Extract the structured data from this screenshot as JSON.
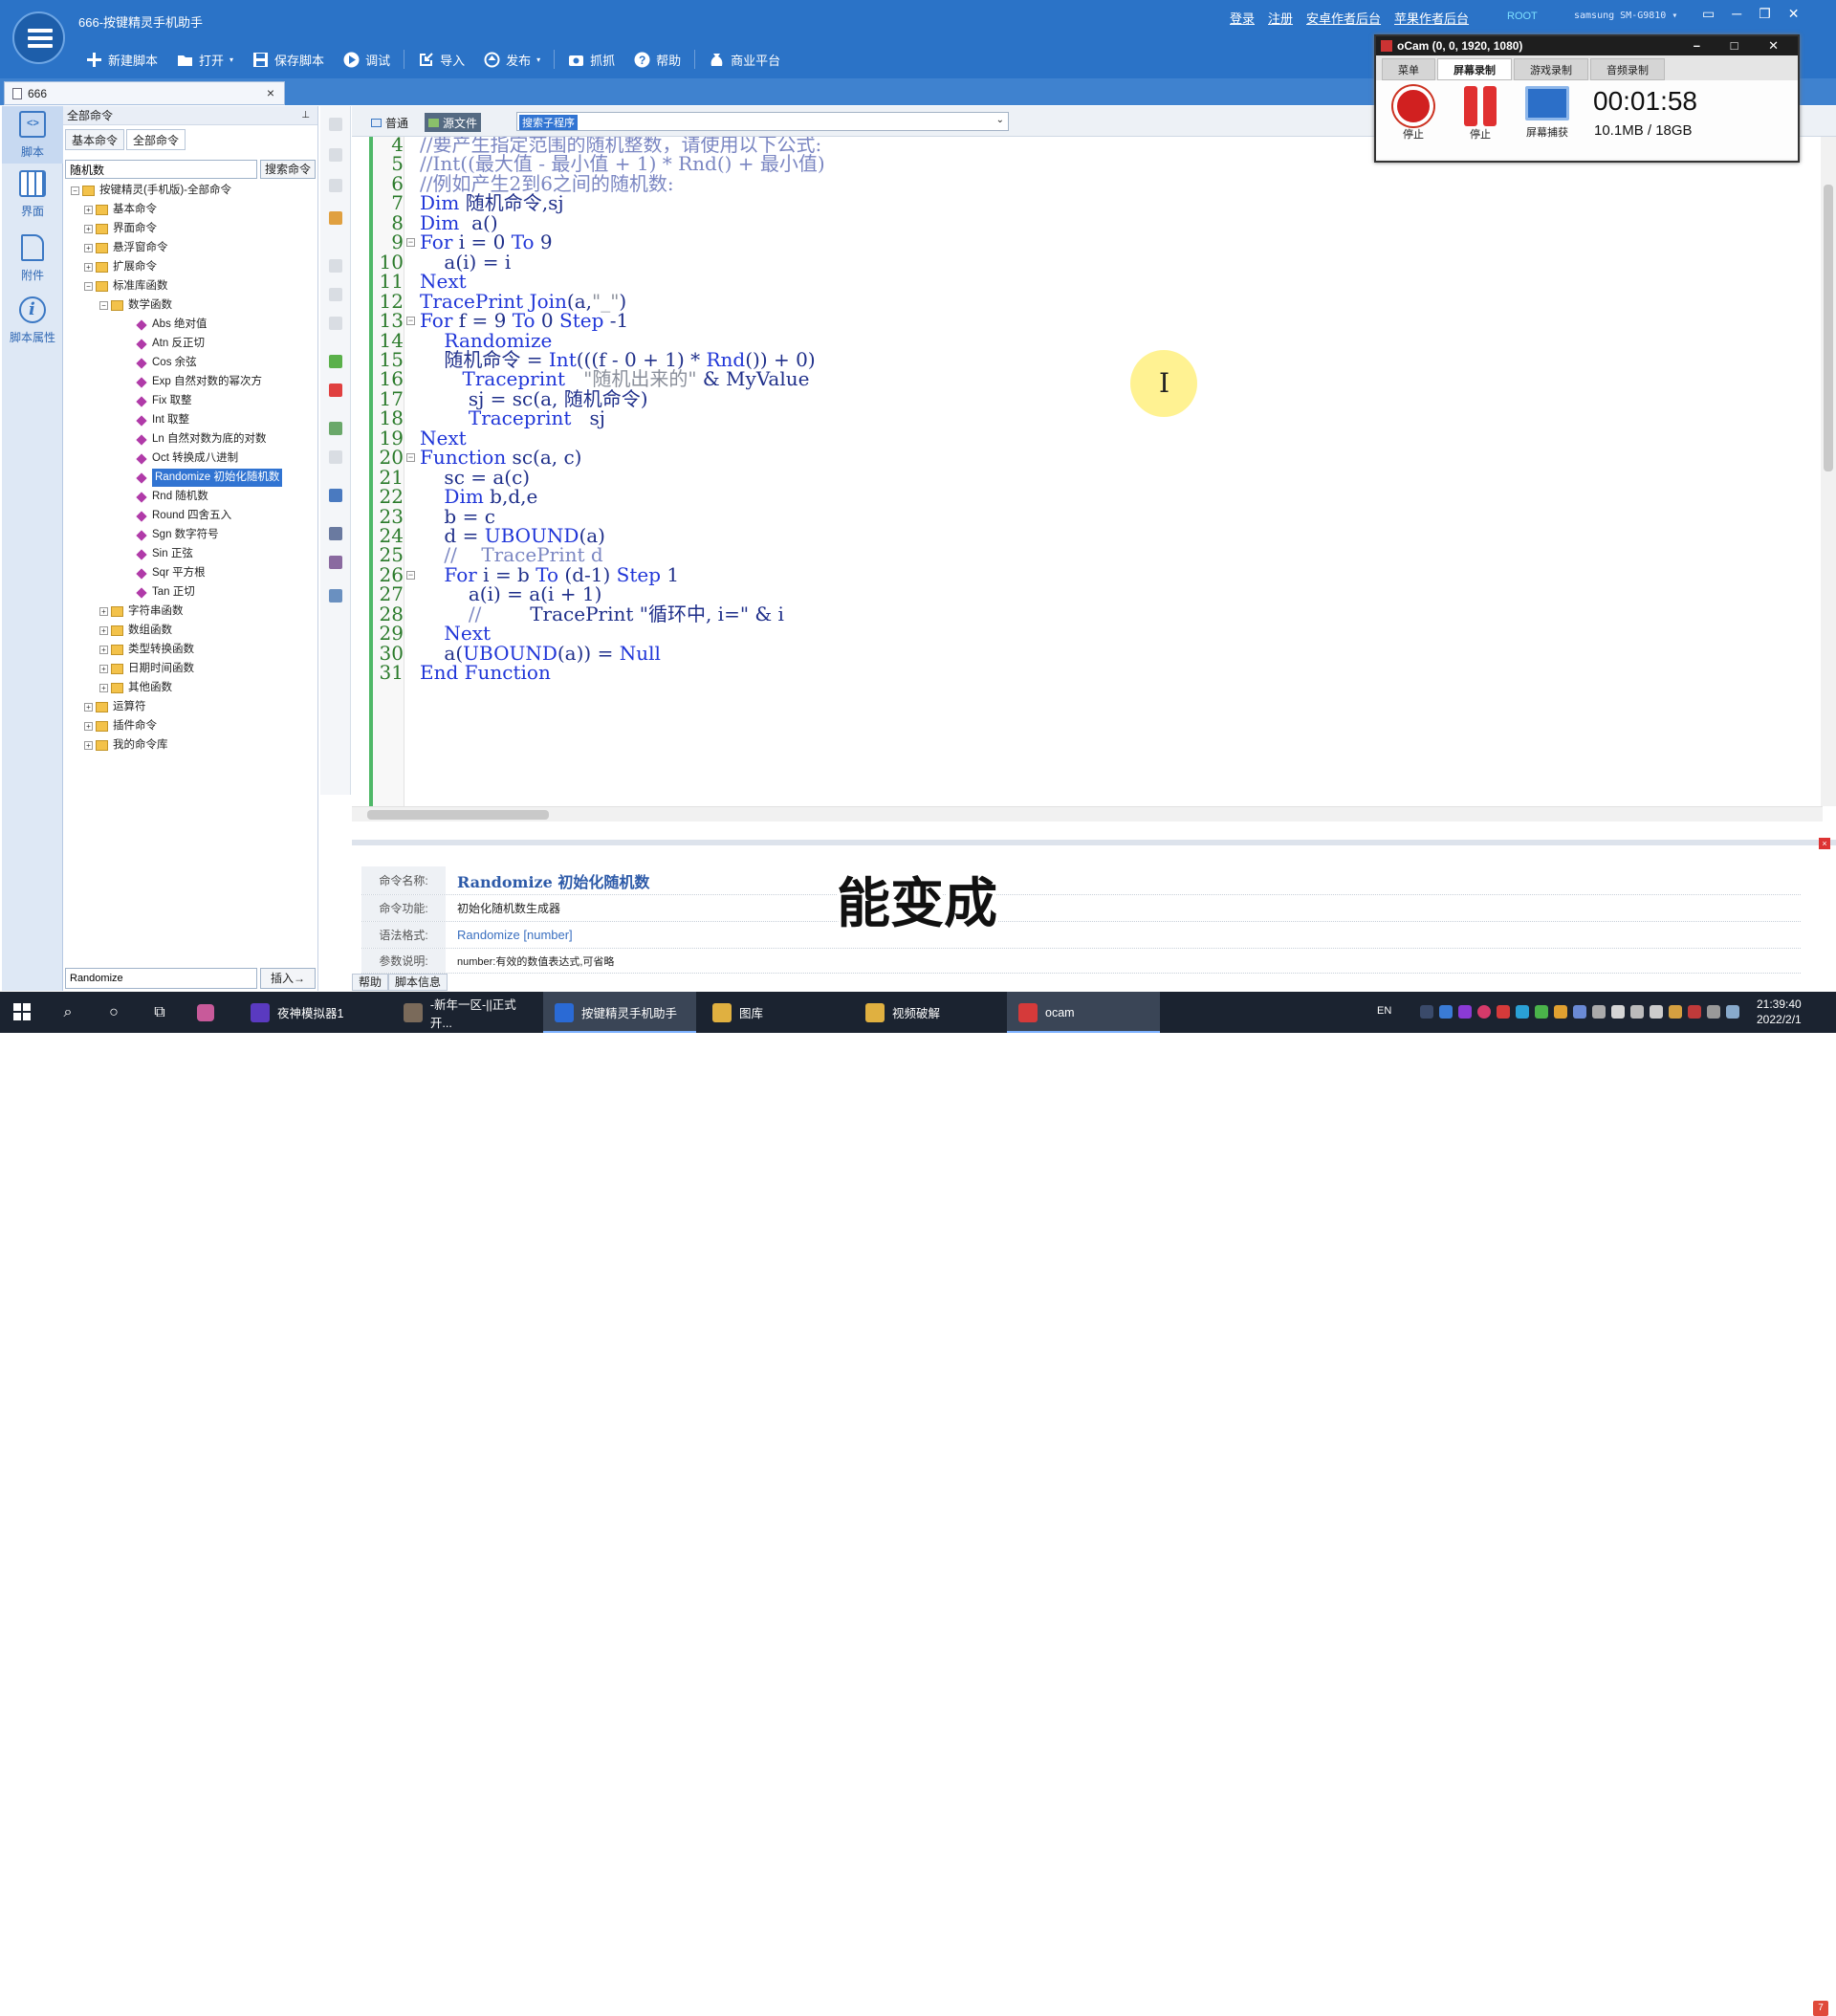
{
  "app": {
    "title": "666-按键精灵手机助手",
    "top_links": [
      "登录",
      "注册",
      "安卓作者后台",
      "苹果作者后台"
    ],
    "root_badge": "ROOT",
    "device": "samsung SM-G9810",
    "window_controls": [
      "▭",
      "─",
      "❐",
      "✕"
    ]
  },
  "toolbar": {
    "items": [
      {
        "label": "新建脚本",
        "icon": "plus-icon"
      },
      {
        "label": "打开",
        "icon": "folder-icon",
        "dropdown": true
      },
      {
        "label": "保存脚本",
        "icon": "save-icon"
      },
      {
        "label": "调试",
        "icon": "play-icon"
      },
      {
        "label": "导入",
        "icon": "import-icon"
      },
      {
        "label": "发布",
        "icon": "publish-icon",
        "dropdown": true
      },
      {
        "label": "抓抓",
        "icon": "camera-icon"
      },
      {
        "label": "帮助",
        "icon": "help-icon"
      },
      {
        "label": "商业平台",
        "icon": "moneybag-icon"
      }
    ]
  },
  "doc_tab": {
    "label": "666",
    "close": "×"
  },
  "leftnav": {
    "items": [
      {
        "label": "脚本",
        "icon": "script-icon",
        "active": true
      },
      {
        "label": "界面",
        "icon": "layout-icon"
      },
      {
        "label": "附件",
        "icon": "attachment-icon"
      },
      {
        "label": "脚本属性",
        "icon": "info-icon"
      }
    ]
  },
  "cmdpanel": {
    "header": "全部命令",
    "pin": "⊥",
    "tabs": [
      "基本命令",
      "全部命令"
    ],
    "search_value": "随机数",
    "search_button": "搜索命令",
    "insert_value": "Randomize",
    "insert_button": "插入→"
  },
  "tree": [
    {
      "label": "按键精灵(手机版)-全部命令",
      "level": 0,
      "exp": "−",
      "kind": "root"
    },
    {
      "label": "基本命令",
      "level": 1,
      "exp": "+",
      "kind": "folder"
    },
    {
      "label": "界面命令",
      "level": 1,
      "exp": "+",
      "kind": "folder"
    },
    {
      "label": "悬浮窗命令",
      "level": 1,
      "exp": "+",
      "kind": "folder"
    },
    {
      "label": "扩展命令",
      "level": 1,
      "exp": "+",
      "kind": "folder"
    },
    {
      "label": "标准库函数",
      "level": 1,
      "exp": "−",
      "kind": "folder"
    },
    {
      "label": "数学函数",
      "level": 2,
      "exp": "−",
      "kind": "folder"
    },
    {
      "label": "Abs 绝对值",
      "level": 3,
      "kind": "leaf"
    },
    {
      "label": "Atn 反正切",
      "level": 3,
      "kind": "leaf"
    },
    {
      "label": "Cos 余弦",
      "level": 3,
      "kind": "leaf"
    },
    {
      "label": "Exp 自然对数的幂次方",
      "level": 3,
      "kind": "leaf"
    },
    {
      "label": "Fix 取整",
      "level": 3,
      "kind": "leaf"
    },
    {
      "label": "Int 取整",
      "level": 3,
      "kind": "leaf"
    },
    {
      "label": "Ln 自然对数为底的对数",
      "level": 3,
      "kind": "leaf"
    },
    {
      "label": "Oct 转换成八进制",
      "level": 3,
      "kind": "leaf"
    },
    {
      "label": "Randomize 初始化随机数",
      "level": 3,
      "kind": "leaf",
      "selected": true
    },
    {
      "label": "Rnd 随机数",
      "level": 3,
      "kind": "leaf"
    },
    {
      "label": "Round 四舍五入",
      "level": 3,
      "kind": "leaf"
    },
    {
      "label": "Sgn 数字符号",
      "level": 3,
      "kind": "leaf"
    },
    {
      "label": "Sin 正弦",
      "level": 3,
      "kind": "leaf"
    },
    {
      "label": "Sqr 平方根",
      "level": 3,
      "kind": "leaf"
    },
    {
      "label": "Tan 正切",
      "level": 3,
      "kind": "leaf"
    },
    {
      "label": "字符串函数",
      "level": 2,
      "exp": "+",
      "kind": "folder"
    },
    {
      "label": "数组函数",
      "level": 2,
      "exp": "+",
      "kind": "folder"
    },
    {
      "label": "类型转换函数",
      "level": 2,
      "exp": "+",
      "kind": "folder"
    },
    {
      "label": "日期时间函数",
      "level": 2,
      "exp": "+",
      "kind": "folder"
    },
    {
      "label": "其他函数",
      "level": 2,
      "exp": "+",
      "kind": "folder"
    },
    {
      "label": "运算符",
      "level": 1,
      "exp": "+",
      "kind": "folder"
    },
    {
      "label": "插件命令",
      "level": 1,
      "exp": "+",
      "kind": "folder"
    },
    {
      "label": "我的命令库",
      "level": 1,
      "exp": "+",
      "kind": "folder"
    }
  ],
  "editor": {
    "view_tabs": [
      {
        "label": "普通"
      },
      {
        "label": "源文件",
        "active": true
      }
    ],
    "proc_select": "搜索子程序",
    "lines": [
      {
        "n": "4",
        "t": [
          [
            "cm",
            "//要产生指定范围的随机整数，请使用以下公式:"
          ]
        ]
      },
      {
        "n": "5",
        "t": [
          [
            "cm",
            "//Int((最大值 - 最小值 + 1) * Rnd() + 最小值)"
          ]
        ]
      },
      {
        "n": "6",
        "t": [
          [
            "cm",
            "//例如产生2到6之间的随机数:"
          ]
        ]
      },
      {
        "n": "7",
        "t": [
          [
            "kw",
            "Dim"
          ],
          [
            "fn",
            " 随机命令,sj"
          ]
        ]
      },
      {
        "n": "8",
        "t": [
          [
            "kw",
            "Dim"
          ],
          [
            "fn",
            "  a()"
          ]
        ]
      },
      {
        "n": "9",
        "fold": true,
        "t": [
          [
            "kw",
            "For"
          ],
          [
            "fn",
            " i = 0 "
          ],
          [
            "kw",
            "To"
          ],
          [
            "fn",
            " 9"
          ]
        ]
      },
      {
        "n": "10",
        "t": [
          [
            "fn",
            "    a(i) = i"
          ]
        ]
      },
      {
        "n": "11",
        "t": [
          [
            "kw",
            "Next"
          ]
        ]
      },
      {
        "n": "12",
        "t": [
          [
            "kw",
            "TracePrint"
          ],
          [
            "fn",
            " "
          ],
          [
            "kw",
            "Join"
          ],
          [
            "fn",
            "(a,"
          ],
          [
            "st",
            "\"_\""
          ],
          [
            "fn",
            ")"
          ]
        ]
      },
      {
        "n": "13",
        "fold": true,
        "t": [
          [
            "kw",
            "For"
          ],
          [
            "fn",
            " f = 9 "
          ],
          [
            "kw",
            "To"
          ],
          [
            "fn",
            " 0 "
          ],
          [
            "kw",
            "Step"
          ],
          [
            "fn",
            " -1"
          ]
        ]
      },
      {
        "n": "14",
        "t": [
          [
            "kw",
            "    Randomize"
          ]
        ]
      },
      {
        "n": "15",
        "t": [
          [
            "fn",
            "    随机命令 = "
          ],
          [
            "kw",
            "Int"
          ],
          [
            "fn",
            "(((f - 0 + 1) * "
          ],
          [
            "kw",
            "Rnd"
          ],
          [
            "fn",
            "()) + 0)"
          ]
        ]
      },
      {
        "n": "16",
        "t": [
          [
            "kw",
            "       Traceprint"
          ],
          [
            "fn",
            "   "
          ],
          [
            "st",
            "\"随机出来的\""
          ],
          [
            "fn",
            " & MyValue"
          ]
        ]
      },
      {
        "n": "17",
        "t": [
          [
            "fn",
            "        sj = sc(a, 随机命令)"
          ]
        ]
      },
      {
        "n": "18",
        "t": [
          [
            "kw",
            "        Traceprint"
          ],
          [
            "fn",
            "   sj"
          ]
        ]
      },
      {
        "n": "19",
        "t": [
          [
            "kw",
            "Next"
          ]
        ]
      },
      {
        "n": "20",
        "fold": true,
        "t": [
          [
            "kw",
            "Function"
          ],
          [
            "fn",
            " sc(a, c)"
          ]
        ]
      },
      {
        "n": "21",
        "t": [
          [
            "fn",
            "    sc = a(c)"
          ]
        ]
      },
      {
        "n": "22",
        "t": [
          [
            "kw",
            "    Dim"
          ],
          [
            "fn",
            " b,d,e"
          ]
        ]
      },
      {
        "n": "23",
        "t": [
          [
            "fn",
            "    b = c"
          ]
        ]
      },
      {
        "n": "24",
        "t": [
          [
            "fn",
            "    d = "
          ],
          [
            "kw",
            "UBOUND"
          ],
          [
            "fn",
            "(a)"
          ]
        ]
      },
      {
        "n": "25",
        "t": [
          [
            "cm",
            "    //    TracePrint d"
          ]
        ]
      },
      {
        "n": "26",
        "fold": true,
        "t": [
          [
            "kw",
            "    For"
          ],
          [
            "fn",
            " i = b "
          ],
          [
            "kw",
            "To"
          ],
          [
            "fn",
            " (d-1) "
          ],
          [
            "kw",
            "Step"
          ],
          [
            "fn",
            " 1"
          ]
        ]
      },
      {
        "n": "27",
        "t": [
          [
            "fn",
            "        a(i) = a(i + 1)"
          ]
        ]
      },
      {
        "n": "28",
        "t": [
          [
            "cm",
            "        //        "
          ],
          [
            "fn",
            "TracePrint "
          ],
          [
            "fn",
            "\"循环中, i=\" & i"
          ]
        ]
      },
      {
        "n": "29",
        "t": [
          [
            "kw",
            "    Next"
          ]
        ]
      },
      {
        "n": "30",
        "t": [
          [
            "fn",
            "    a("
          ],
          [
            "kw",
            "UBOUND"
          ],
          [
            "fn",
            "(a)) = "
          ],
          [
            "kw",
            "Null"
          ]
        ]
      },
      {
        "n": "31",
        "t": [
          [
            "kw",
            "End Function"
          ]
        ]
      }
    ]
  },
  "help": {
    "rows": [
      {
        "label": "命令名称:",
        "value": "Randomize 初始化随机数",
        "style": "name"
      },
      {
        "label": "命令功能:",
        "value": "初始化随机数生成器",
        "style": "plain"
      },
      {
        "label": "语法格式:",
        "value": "Randomize [number]",
        "style": "link"
      },
      {
        "label": "参数说明:",
        "value": "number:有效的数值表达式,可省略",
        "style": "small"
      }
    ],
    "tabs": [
      "帮助",
      "脚本信息"
    ],
    "close": "×"
  },
  "subtitle": "能变成",
  "ocam": {
    "title": "oCam (0, 0, 1920, 1080)",
    "tabs": [
      "菜单",
      "屏幕录制",
      "游戏录制",
      "音频录制"
    ],
    "active_tab": "屏幕录制",
    "buttons": [
      "停止",
      "停止",
      "屏幕捕获"
    ],
    "timer": "00:01:58",
    "size": "10.1MB / 18GB",
    "controls": "– □ ✕"
  },
  "taskbar": {
    "items": [
      {
        "label": "夜神模拟器1"
      },
      {
        "label": "-新年一区-||正式开..."
      },
      {
        "label": "按键精灵手机助手",
        "active": true
      },
      {
        "label": "图库"
      },
      {
        "label": "视频破解"
      },
      {
        "label": "ocam",
        "active": true
      }
    ],
    "lang": "EN",
    "time": "21:39:40",
    "date": "2022/2/1",
    "notif": "7"
  }
}
